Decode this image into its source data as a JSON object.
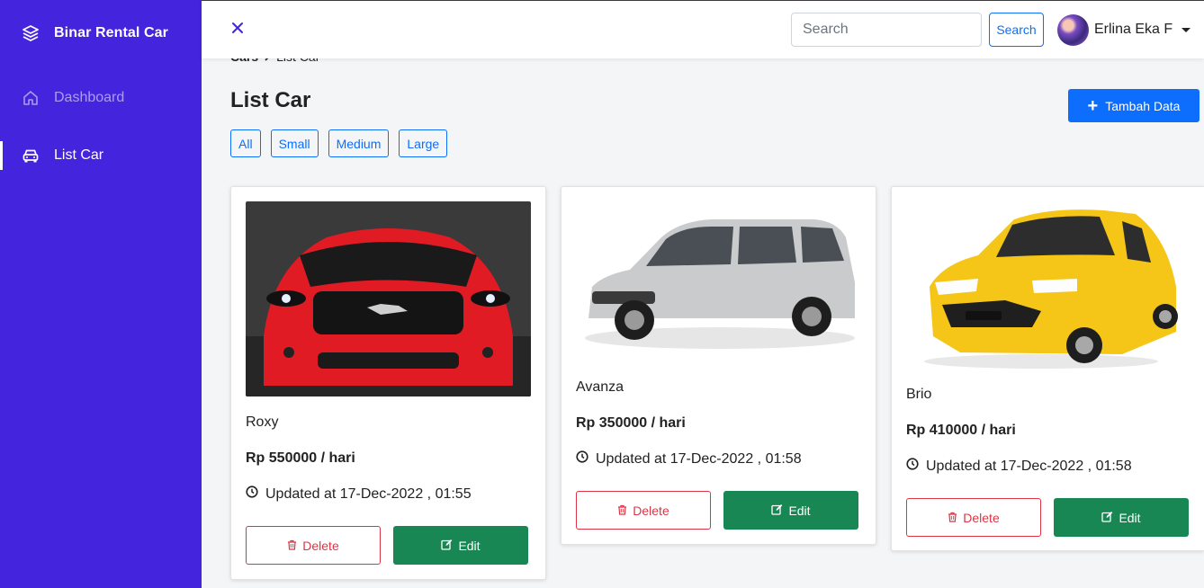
{
  "sidebar": {
    "brand": "Binar Rental Car",
    "items": [
      {
        "label": "Dashboard",
        "icon": "home-icon",
        "active": false
      },
      {
        "label": "List Car",
        "icon": "car-icon",
        "active": true
      }
    ]
  },
  "topbar": {
    "close_icon": "close-icon",
    "search_placeholder": "Search",
    "search_value": "",
    "search_button": "Search",
    "user_name": "Erlina Eka F"
  },
  "breadcrumb": {
    "root": "Cars",
    "current": "List Car"
  },
  "page_title": "List Car",
  "add_button": "Tambah Data",
  "filters": [
    "All",
    "Small",
    "Medium",
    "Large"
  ],
  "cars": [
    {
      "name": "Roxy",
      "price": "Rp 550000 / hari",
      "updated": "Updated at 17-Dec-2022 , 01:55",
      "delete_label": "Delete",
      "edit_label": "Edit",
      "color": "#e01b24"
    },
    {
      "name": "Avanza",
      "price": "Rp 350000 / hari",
      "updated": "Updated at 17-Dec-2022 , 01:58",
      "delete_label": "Delete",
      "edit_label": "Edit",
      "color": "#c9cbcd"
    },
    {
      "name": "Brio",
      "price": "Rp 410000 / hari",
      "updated": "Updated at 17-Dec-2022 , 01:58",
      "delete_label": "Delete",
      "edit_label": "Edit",
      "color": "#f5c518"
    }
  ],
  "colors": {
    "sidebar_bg": "#4424dc",
    "primary": "#0d6efd",
    "success": "#198754",
    "danger": "#dc3545"
  }
}
